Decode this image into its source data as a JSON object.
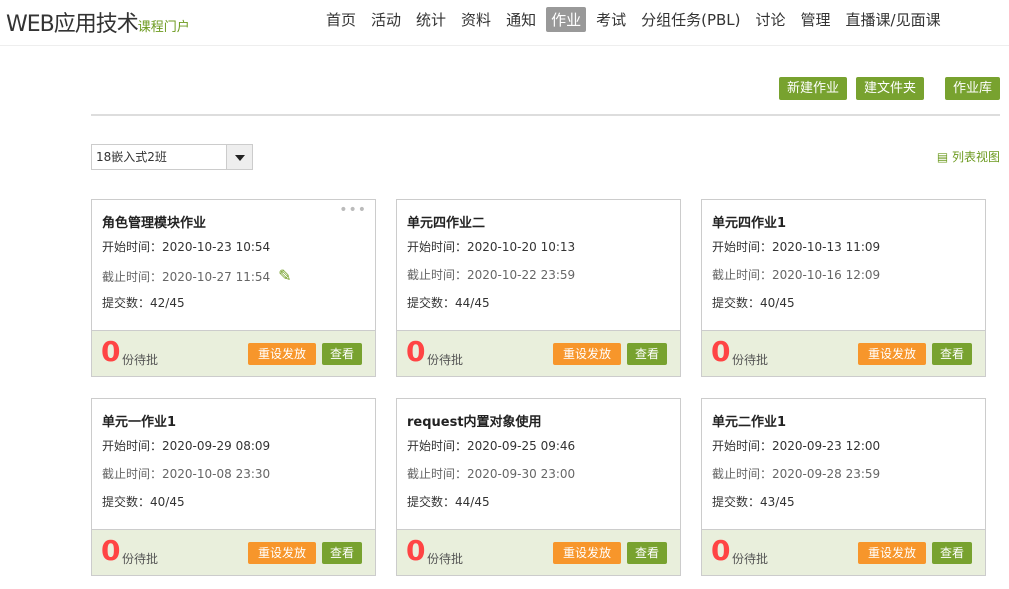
{
  "header": {
    "title": "WEB应用技术",
    "subtitle": "课程门户",
    "nav": [
      "首页",
      "活动",
      "统计",
      "资料",
      "通知",
      "作业",
      "考试",
      "分组任务(PBL)",
      "讨论",
      "管理",
      "直播课/见面课"
    ],
    "active_index": 5
  },
  "toolbar": {
    "new": "新建作业",
    "folder": "建文件夹",
    "library": "作业库"
  },
  "class_select": {
    "value": "18嵌入式2班"
  },
  "list_view": "列表视图",
  "labels": {
    "start": "开始时间：",
    "end": "截止时间：",
    "submit": "提交数：",
    "pending": "份待批",
    "reset": "重设发放",
    "view": "查看"
  },
  "cards": [
    {
      "title": "角色管理模块作业",
      "start": "2020-10-23 10:54",
      "end": "2020-10-27 11:54",
      "submit": "42/45",
      "pending": "0"
    },
    {
      "title": "单元四作业二",
      "start": "2020-10-20 10:13",
      "end": "2020-10-22 23:59",
      "submit": "44/45",
      "pending": "0"
    },
    {
      "title": "单元四作业1",
      "start": "2020-10-13 11:09",
      "end": "2020-10-16 12:09",
      "submit": "40/45",
      "pending": "0"
    },
    {
      "title": "单元一作业1",
      "start": "2020-09-29 08:09",
      "end": "2020-10-08 23:30",
      "submit": "40/45",
      "pending": "0"
    },
    {
      "title": "request内置对象使用",
      "start": "2020-09-25 09:46",
      "end": "2020-09-30 23:00",
      "submit": "44/45",
      "pending": "0"
    },
    {
      "title": "单元二作业1",
      "start": "2020-09-23 12:00",
      "end": "2020-09-28 23:59",
      "submit": "43/45",
      "pending": "0"
    }
  ]
}
